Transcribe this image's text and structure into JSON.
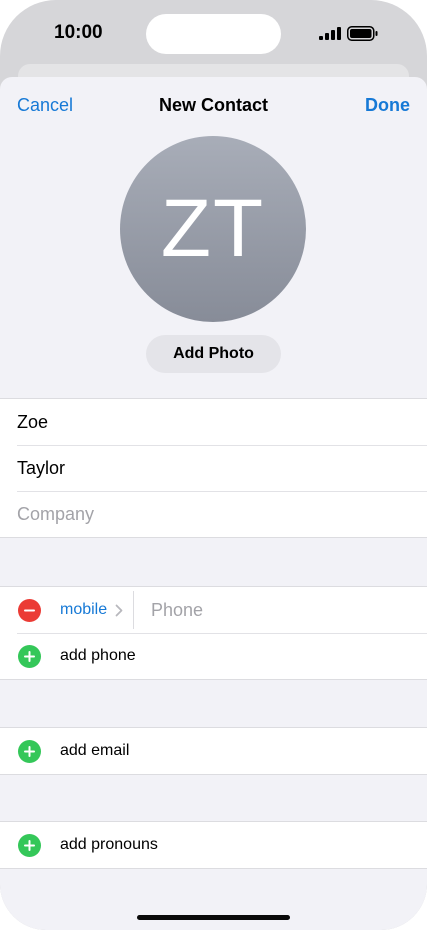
{
  "status_bar": {
    "time": "10:00"
  },
  "nav": {
    "cancel": "Cancel",
    "title": "New Contact",
    "done": "Done"
  },
  "avatar": {
    "initials": "ZT"
  },
  "add_photo": "Add Photo",
  "name_fields": {
    "first_name": "Zoe",
    "last_name": "Taylor",
    "company_placeholder": "Company"
  },
  "phone": {
    "type": "mobile",
    "placeholder": "Phone",
    "add_label": "add phone"
  },
  "email": {
    "add_label": "add email"
  },
  "pronouns": {
    "add_label": "add pronouns"
  },
  "colors": {
    "accent": "#1679d6",
    "remove": "#eb3b35",
    "add": "#34c759",
    "sheet_background": "#f2f2f7"
  }
}
